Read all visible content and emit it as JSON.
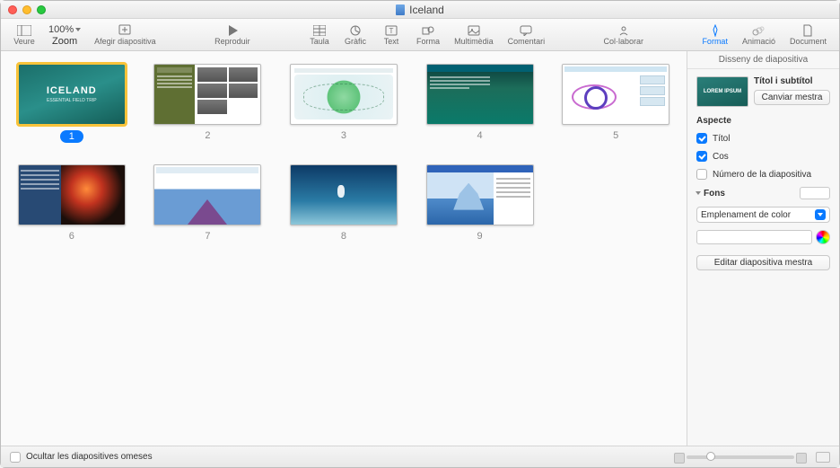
{
  "window": {
    "title": "Iceland"
  },
  "toolbar": {
    "view": "Veure",
    "zoom_label": "Zoom",
    "zoom_value": "100%",
    "add_slide": "Afegir diapositiva",
    "play": "Reproduir",
    "table": "Taula",
    "chart": "Gràfic",
    "text": "Text",
    "shape": "Forma",
    "media": "Multimèdia",
    "comment": "Comentari",
    "collaborate": "Col·laborar",
    "format": "Format",
    "animate": "Animació",
    "document": "Document"
  },
  "slides": {
    "items": [
      {
        "num": "1",
        "title": "ICELAND",
        "subtitle": "ESSENTIAL FIELD TRIP",
        "selected": true
      },
      {
        "num": "2"
      },
      {
        "num": "3"
      },
      {
        "num": "4"
      },
      {
        "num": "5"
      },
      {
        "num": "6"
      },
      {
        "num": "7"
      },
      {
        "num": "8"
      },
      {
        "num": "9"
      }
    ]
  },
  "inspector": {
    "header": "Disseny de diapositiva",
    "master_preview_text": "LOREM IPSUM",
    "master_name": "Títol i subtítol",
    "change_master": "Canviar mestra",
    "appearance_section": "Aspecte",
    "title_check_label": "Títol",
    "title_checked": true,
    "body_check_label": "Cos",
    "body_checked": true,
    "slidenum_check_label": "Número de la diapositiva",
    "slidenum_checked": false,
    "background_section": "Fons",
    "fill_select_label": "Emplenament de color",
    "edit_master": "Editar diapositiva mestra"
  },
  "footer": {
    "hide_skipped": "Ocultar les diapositives omeses"
  }
}
